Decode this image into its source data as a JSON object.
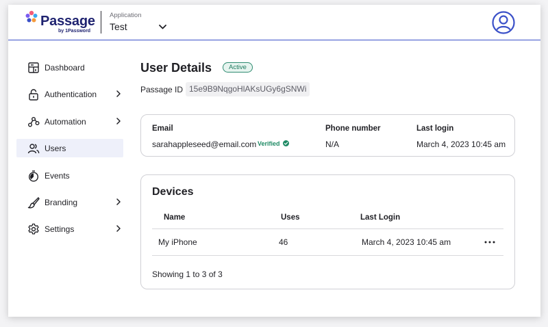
{
  "header": {
    "logo_text": "Passage",
    "logo_sub": "by 1Password",
    "app_label": "Application",
    "app_value": "Test",
    "icons": {
      "chevron": "chevron-down-icon",
      "account": "user-circle-icon"
    }
  },
  "sidebar": {
    "items": [
      {
        "label": "Dashboard",
        "icon": "dashboard-icon",
        "has_chevron": false,
        "active": false
      },
      {
        "label": "Authentication",
        "icon": "lock-icon",
        "has_chevron": true,
        "active": false
      },
      {
        "label": "Automation",
        "icon": "automation-icon",
        "has_chevron": true,
        "active": false
      },
      {
        "label": "Users",
        "icon": "users-icon",
        "has_chevron": false,
        "active": true
      },
      {
        "label": "Events",
        "icon": "stopwatch-icon",
        "has_chevron": false,
        "active": false
      },
      {
        "label": "Branding",
        "icon": "brush-icon",
        "has_chevron": true,
        "active": false
      },
      {
        "label": "Settings",
        "icon": "gear-icon",
        "has_chevron": true,
        "active": false
      }
    ]
  },
  "main": {
    "title": "User Details",
    "status": "Active",
    "passage_id_label": "Passage ID",
    "passage_id_value": "15e9B9NqgoHlAKsUGy6gSNWi",
    "user_card": {
      "email_label": "Email",
      "email_value": "sarahappleseed@email.com",
      "verified_label": "Verified",
      "phone_label": "Phone number",
      "phone_value": "N/A",
      "last_login_label": "Last login",
      "last_login_value": "March 4, 2023 10:45 am"
    },
    "devices": {
      "title": "Devices",
      "columns": [
        "Name",
        "Uses",
        "Last Login"
      ],
      "rows": [
        {
          "name": "My iPhone",
          "uses": "46",
          "last_login": "March 4, 2023 10:45 am"
        }
      ],
      "pagination": "Showing 1 to 3 of 3"
    }
  },
  "colors": {
    "accent": "#3a50c8",
    "brand_dark": "#1f2370",
    "active_nav_bg": "#eef0fa",
    "status_green": "#1d7a5e"
  }
}
